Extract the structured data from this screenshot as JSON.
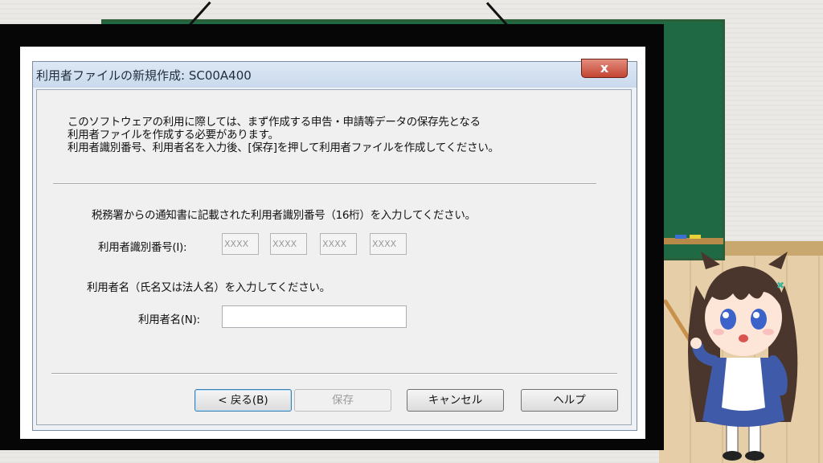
{
  "dialog": {
    "title": "利用者ファイルの新規作成: SC00A400",
    "close_label": "x",
    "intro_lines": [
      "このソフトウェアの利用に際しては、まず作成する申告・申請等データの保存先となる",
      "利用者ファイルを作成する必要があります。",
      "利用者識別番号、利用者名を入力後、[保存]を押して利用者ファイルを作成してください。"
    ],
    "id_prompt": "税務署からの通知書に記載された利用者識別番号（16桁）を入力してください。",
    "id_label": "利用者識別番号(I):",
    "id_fields": [
      "XXXX",
      "XXXX",
      "XXXX",
      "XXXX"
    ],
    "name_prompt": "利用者名（氏名又は法人名）を入力してください。",
    "name_label": "利用者名(N):",
    "name_value": "",
    "buttons": {
      "back": "< 戻る(B)",
      "save": "保存",
      "cancel": "キャンセル",
      "help": "ヘルプ"
    }
  },
  "colors": {
    "blackboard": "#1f6a44",
    "frame": "#060606",
    "close_button": "#c34431",
    "dress": "#3f5aa8",
    "hair": "#4a362c"
  }
}
